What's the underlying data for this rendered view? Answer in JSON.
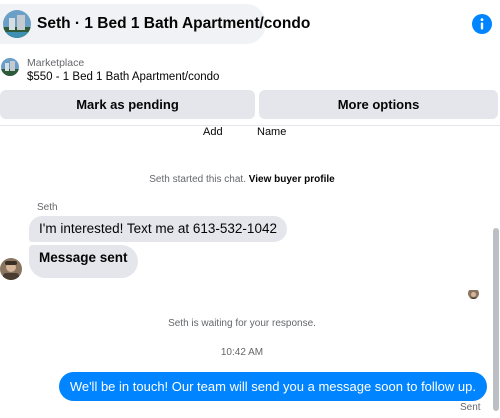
{
  "header": {
    "title": "Seth · 1 Bed 1 Bath Apartment/condo"
  },
  "marketplace": {
    "label": "Marketplace",
    "listing": "$550 - 1 Bed 1 Bath Apartment/condo"
  },
  "actions": {
    "pending_label": "Mark as pending",
    "more_label": "More options"
  },
  "add_name": {
    "add": "Add",
    "name": "Name"
  },
  "chat": {
    "started_text": "Seth started this chat.",
    "view_profile": "View buyer profile",
    "sender_name": "Seth",
    "incoming": [
      "I'm interested! Text me at 613-532-1042",
      "Message sent"
    ],
    "waiting_text": "Seth is waiting for your response.",
    "timestamp": "10:42 AM",
    "outgoing": "We'll be in touch! Our team will send you a message soon to follow up.",
    "status": "Sent"
  },
  "colors": {
    "accent": "#0084ff",
    "bubble_in": "#e4e6eb",
    "button_bg": "#e4e6eb"
  }
}
